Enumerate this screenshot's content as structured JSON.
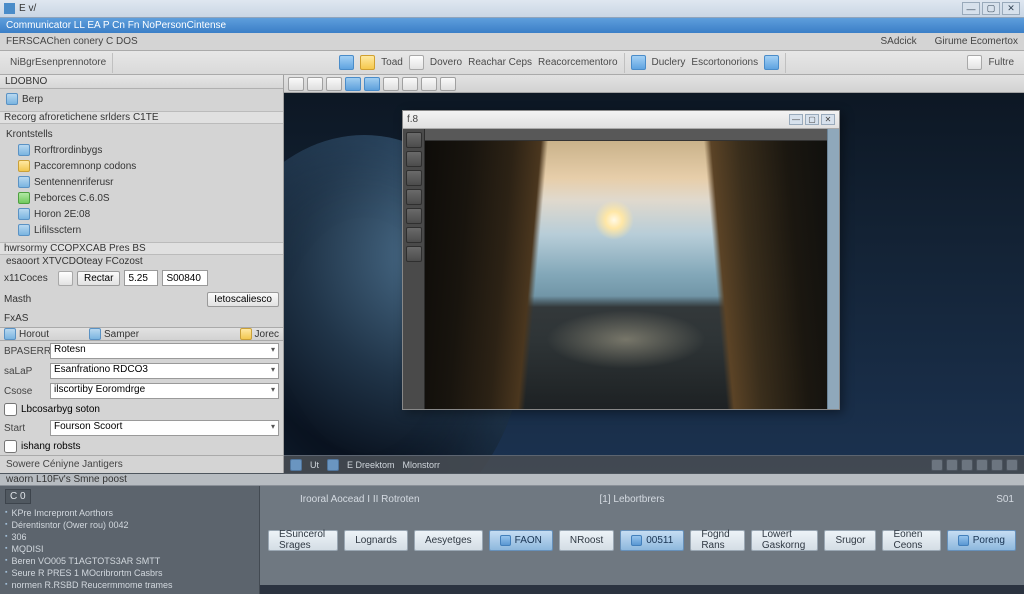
{
  "window": {
    "app_title": "E v/",
    "subtitle": "Communicator LL EA P Cn Fn NoPersonCintense",
    "min": "—",
    "max": "▢",
    "close": "✕"
  },
  "menubar": {
    "item1": "FERSCAChen conery C DOS",
    "item2": "SAdcick",
    "item3": "Girume Ecomertox"
  },
  "toolbar": {
    "sec_a_label": "NiBgrEsenprennotore",
    "btn_toad": "Toad",
    "btn_dovero": "Dovero",
    "btn_reachar": "Reachar Ceps",
    "btn_reacorc": "Reacorcementoro",
    "btn_dudery": "Duclery",
    "btn_escortonos": "Escortonorions",
    "btn_fultre": "Fultre"
  },
  "sidebar": {
    "hdr1": "LDOBNO",
    "itm_berp": "Berp",
    "grp_research": "Recorg afroretichene srlders  C1TE",
    "lbl_kontsells": "Krontstells",
    "tree": [
      "Rorftrordinbygs",
      "Paccoremnonp codons",
      "Sentennenriferusr",
      "Peborces C.6.0S",
      "Horon 2E:08",
      "Lifilssctern"
    ],
    "grp_hwset": "hwrsormy CCOPXCAB Pres BS",
    "grp_esaoot": "esaoort XTVCDOteay FCozost",
    "lbl_x11": "x11Coces",
    "btn_rectar": "Rectar",
    "inp_rectar_val": "5.25",
    "inp_sobtid": "S00840",
    "lbl_mash": "Masth",
    "btn_ieto": "Ietoscaliesco",
    "lbl_pxas": "FxAS",
    "panel_tab1": "Horout",
    "panel_tab2": "Samper",
    "panel_tab3": "Jorec",
    "lbl_bpasers": "BPASERRs",
    "lbl_salap": "saLaP",
    "sel_rotesn": "Rotesn",
    "sel_sandris": "Esanfrationo RDCO3",
    "lbl_csose": "Csose",
    "sel_ilscor": "ilscortiby Eoromdrge",
    "chk_tecorc": "Lbcosarbyg soton",
    "lbl_start": "Start",
    "sel_fourson": "Fourson Scoort",
    "lbl_che": "ishang robsts",
    "ftr_caption": "Sowere Céniyne Jantigers"
  },
  "canvas": {
    "child_title": "f.8",
    "status_left1": "Ut",
    "status_left2": "E Dreektom",
    "status_left3": "Mlonstorr",
    "status_tray_items": 6
  },
  "info_line": {
    "a": "Irooral Aocead I II Rotroten",
    "b": "[1] Lebortbrers",
    "c": "S01"
  },
  "footer": {
    "top_caption": "waorn L10Fv's Smne poost",
    "output_hdr": "C 0",
    "output_lines": [
      "KPre Imcrepront Aorthors",
      "Dérentisntor  (Ower rou)  0042",
      "306",
      "MQDISI",
      "Beren VO005 T1AGTOTS3AR SMTT",
      "Seure R PRES 1  MOcribrortm Casbrs",
      "normen R.RSBD Reucermmome trames"
    ],
    "tabs": [
      {
        "label": "ESuncerol Srages",
        "blue": false
      },
      {
        "label": "Lognards",
        "blue": false
      },
      {
        "label": "Aesyetges",
        "blue": false
      },
      {
        "label": "FAON",
        "blue": true
      },
      {
        "label": "NRoost",
        "blue": false
      },
      {
        "label": "00511",
        "blue": true
      },
      {
        "label": "Fognd Rans",
        "blue": false
      },
      {
        "label": "Lowert Gaskorng",
        "blue": false
      },
      {
        "label": "Srugor",
        "blue": false
      },
      {
        "label": "Eonen Ceons",
        "blue": false
      },
      {
        "label": "Poreng",
        "blue": true
      }
    ]
  }
}
